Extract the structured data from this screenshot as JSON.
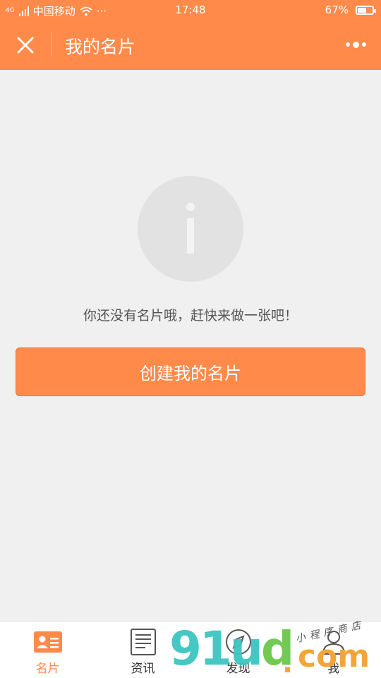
{
  "status_bar": {
    "carrier": "中国移动",
    "network": "4G",
    "extra": "···",
    "time": "17:48",
    "battery": "67%",
    "battery_level": 0.67
  },
  "nav": {
    "title": "我的名片",
    "close_icon": "close-icon",
    "more_icon": "more-icon"
  },
  "content": {
    "empty_message": "你还没有名片哦，赶快来做一张吧！",
    "create_button": "创建我的名片",
    "info_icon": "info-icon"
  },
  "tabs": [
    {
      "label": "名片",
      "icon": "card-icon",
      "active": true
    },
    {
      "label": "资讯",
      "icon": "news-icon",
      "active": false
    },
    {
      "label": "发现",
      "icon": "compass-icon",
      "active": false
    },
    {
      "label": "我",
      "icon": "person-icon",
      "active": false
    }
  ],
  "watermark": {
    "brand": "91ud",
    "domain": ".com",
    "slogan": "小程序商店"
  },
  "colors": {
    "accent": "#ff8a4a",
    "background": "#f0f0f0",
    "tab_inactive": "#333333"
  }
}
